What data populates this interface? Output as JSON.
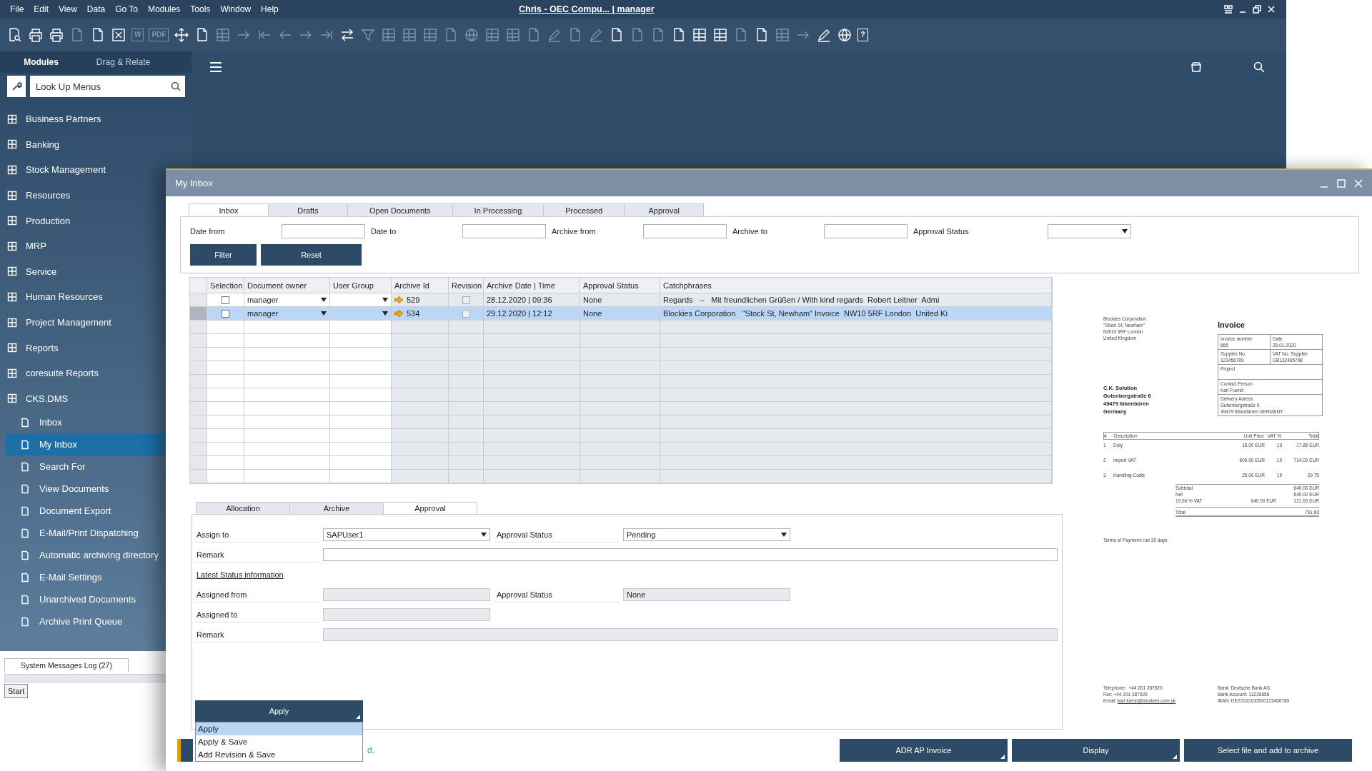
{
  "menu_bar": {
    "items": [
      "File",
      "Edit",
      "View",
      "Data",
      "Go To",
      "Modules",
      "Tools",
      "Window",
      "Help"
    ],
    "title": "Chris - OEC Compu... | manager"
  },
  "toolbar": [
    {
      "disabled": false
    },
    {
      "disabled": false
    },
    {
      "disabled": false
    },
    {
      "disabled": true
    },
    {
      "disabled": false
    },
    {
      "disabled": false
    },
    {
      "disabled": true,
      "label": "W"
    },
    {
      "disabled": true,
      "label": "PDF"
    },
    {
      "disabled": false
    },
    {
      "disabled": false
    },
    {
      "disabled": true
    },
    {
      "disabled": true
    },
    {
      "disabled": true
    },
    {
      "disabled": true
    },
    {
      "disabled": true
    },
    {
      "disabled": true
    },
    {
      "disabled": false
    },
    {
      "disabled": true
    },
    {
      "disabled": true
    },
    {
      "disabled": true
    },
    {
      "disabled": true
    },
    {
      "disabled": true
    },
    {
      "disabled": true
    },
    {
      "disabled": true
    },
    {
      "disabled": true
    },
    {
      "disabled": true
    },
    {
      "disabled": true
    },
    {
      "disabled": true
    },
    {
      "disabled": true
    },
    {
      "disabled": false
    },
    {
      "disabled": true
    },
    {
      "disabled": true
    },
    {
      "disabled": false
    },
    {
      "disabled": false
    },
    {
      "disabled": false
    },
    {
      "disabled": true
    },
    {
      "disabled": false
    },
    {
      "disabled": true
    },
    {
      "disabled": true
    },
    {
      "disabled": false
    },
    {
      "disabled": false
    },
    {
      "disabled": false,
      "label": "?"
    }
  ],
  "sidebar": {
    "tabs": [
      {
        "label": "Modules",
        "selected": true
      },
      {
        "label": "Drag & Relate",
        "selected": false
      }
    ],
    "search": {
      "placeholder": "Look Up Menus"
    },
    "items": [
      {
        "label": "Business Partners",
        "selected": false
      },
      {
        "label": "Banking",
        "selected": false
      },
      {
        "label": "Stock Management",
        "selected": false
      },
      {
        "label": "Resources",
        "selected": false
      },
      {
        "label": "Production",
        "selected": false
      },
      {
        "label": "MRP",
        "selected": false
      },
      {
        "label": "Service",
        "selected": false
      },
      {
        "label": "Human Resources",
        "selected": false
      },
      {
        "label": "Project Management",
        "selected": false
      },
      {
        "label": "Reports",
        "selected": false
      },
      {
        "label": "coresuite Reports",
        "selected": false
      },
      {
        "label": "CKS.DMS",
        "selected": false,
        "children": [
          {
            "label": "Inbox",
            "selected": false
          },
          {
            "label": "My Inbox",
            "selected": true
          },
          {
            "label": "Search For",
            "selected": false
          },
          {
            "label": "View Documents",
            "selected": false
          },
          {
            "label": "Document Export",
            "selected": false
          },
          {
            "label": "E-Mail/Print Dispatching",
            "selected": false
          },
          {
            "label": "Automatic archiving directory",
            "selected": false
          },
          {
            "label": "E-Mail Settings",
            "selected": false
          },
          {
            "label": "Unarchived Documents",
            "selected": false
          },
          {
            "label": "Archive Print Queue",
            "selected": false
          }
        ]
      }
    ]
  },
  "system_messages": {
    "tab": "System Messages Log (27)",
    "start_button": "Start"
  },
  "inbox_window": {
    "title": "My Inbox",
    "tabs": [
      {
        "label": "Inbox",
        "selected": true
      },
      {
        "label": "Drafts",
        "selected": false
      },
      {
        "label": "Open Documents",
        "selected": false
      },
      {
        "label": "In Processing",
        "selected": false
      },
      {
        "label": "Processed",
        "selected": false
      },
      {
        "label": "Approval",
        "selected": false
      }
    ],
    "filters": [
      {
        "label": "Date from",
        "kind": "text"
      },
      {
        "label": "Date to",
        "kind": "text"
      },
      {
        "label": "Archive from",
        "kind": "text"
      },
      {
        "label": "Archive to",
        "kind": "text"
      },
      {
        "label": "Approval Status",
        "kind": "dropdown"
      }
    ],
    "buttons": [
      "Filter",
      "Reset"
    ],
    "table": {
      "columns": [
        "Selection",
        "Document owner",
        "User Group",
        "Archive Id",
        "Revision",
        "Archive Date | Time",
        "Approval Status",
        "Catchphrases"
      ],
      "rows": [
        {
          "selected": false,
          "checked": false,
          "document_owner": "manager",
          "archive_id": "529",
          "revision_checked": false,
          "archive_date_time": "28.12.2020 | 09:36",
          "approval_status": "None",
          "catchphrases": "Regards   --   Mit freundlichen Grüßen / With kind regards  Robert Leitner  Admi"
        },
        {
          "selected": true,
          "checked": false,
          "document_owner": "manager",
          "archive_id": "534",
          "revision_checked": false,
          "archive_date_time": "29.12.2020 | 12:12",
          "approval_status": "None",
          "catchphrases": "Blockies Corporation   \"Stock St, Newham\" Invoice  NW10 5RF London  United Ki"
        }
      ]
    },
    "detail_tabs": [
      {
        "label": "Allocation",
        "selected": false
      },
      {
        "label": "Archive",
        "selected": false
      },
      {
        "label": "Approval",
        "selected": true
      }
    ],
    "form": [
      {
        "kind": "fields",
        "fields": [
          {
            "label": "Assign to",
            "kind": "dropdown",
            "value": "SAPUser1",
            "disabled": false
          },
          {
            "label": "Approval Status",
            "kind": "dropdown",
            "value": "Pending",
            "disabled": false
          }
        ]
      },
      {
        "kind": "fields",
        "fields": [
          {
            "label": "Remark",
            "kind": "memo",
            "disabled": false
          }
        ]
      },
      {
        "kind": "link",
        "text": "Latest Status information"
      },
      {
        "kind": "fields",
        "fields": [
          {
            "label": "Assigned from",
            "kind": "text",
            "disabled": true
          },
          {
            "label": "Approval Status",
            "kind": "text",
            "value": "None",
            "disabled": true
          }
        ]
      },
      {
        "kind": "fields",
        "fields": [
          {
            "label": "Assigned to",
            "kind": "text",
            "disabled": true
          }
        ]
      },
      {
        "kind": "fields",
        "fields": [
          {
            "label": "Remark",
            "kind": "memo",
            "disabled": true
          }
        ]
      }
    ],
    "apply_button": "Apply",
    "apply_menu": [
      {
        "label": "Apply",
        "selected": true
      },
      {
        "label": "Apply & Save",
        "selected": false
      },
      {
        "label": "Add Revision & Save",
        "selected": false
      }
    ],
    "status_message": "d.",
    "actions": [
      {
        "label": "ADR AP Invoice",
        "has_menu": true
      },
      {
        "label": "Display",
        "has_menu": true
      },
      {
        "label": "Select file and add to archive",
        "has_menu": false
      }
    ],
    "preview": {
      "sender": [
        "Blockies Corporation",
        "\"Stock St, Newham\"",
        "NW10 5RF London",
        "United Kingdom"
      ],
      "title": "Invoice",
      "info_rows": [
        [
          {
            "label": "Invoice number",
            "lines": [
              "665"
            ]
          },
          {
            "label": "Date",
            "lines": [
              "28.01.2020"
            ]
          }
        ],
        [
          {
            "label": "Supplier No.",
            "lines": [
              "123456789"
            ]
          },
          {
            "label": "VAT No. Supplier",
            "lines": [
              "GB132465798"
            ]
          }
        ],
        [
          {
            "label": "Project"
          }
        ],
        [
          {
            "label": "Contact Person",
            "lines": [
              "Karl Fuerst"
            ]
          }
        ],
        [
          {
            "label": "Delivery Adress",
            "lines": [
              "Gutenbergstraße 6",
              "49479 Ibbenbüren GERMANY"
            ]
          }
        ]
      ],
      "recipient": [
        "C.K. Solution",
        "Gutenbergstraße 6",
        "49479 Ibbenbüren",
        "Germany"
      ],
      "items_header": [
        "#",
        "Description",
        "Unit Price",
        "VAT %",
        "Total"
      ],
      "items": [
        [
          "1",
          "Duty",
          "15.00 EUR",
          "19",
          "17.85 EUR"
        ],
        [
          "2",
          "Import VAT",
          "600.00 EUR",
          "19",
          "714,00 EUR"
        ],
        [
          "3",
          "Handling Costs",
          "25.00 EUR",
          "19",
          "29,75"
        ]
      ],
      "totals": [
        {
          "label": "Subtotal",
          "total": "640.00 EUR",
          "kind": "line"
        },
        {
          "label": "Net",
          "total": "640.00 EUR",
          "kind": "line"
        },
        {
          "label": "19.00 % VAT",
          "base": "640.00 EUR",
          "total": "121.60 EUR",
          "kind": "line"
        },
        {
          "label": "Total",
          "total": "761,60",
          "kind": "grand"
        }
      ],
      "terms": "Terms of Payment: net 30 days",
      "contact": [
        "Telephone:  +44 201 287920",
        "Fax: +44 201 287929"
      ],
      "email": {
        "label": "Email:",
        "address": "karl.fuerst@blockies.com.uk"
      },
      "bank": [
        "Bank: Deutsche Bank AG",
        "Bank Account: 13226656",
        "IBAN: DE22100100500123456789"
      ]
    }
  }
}
